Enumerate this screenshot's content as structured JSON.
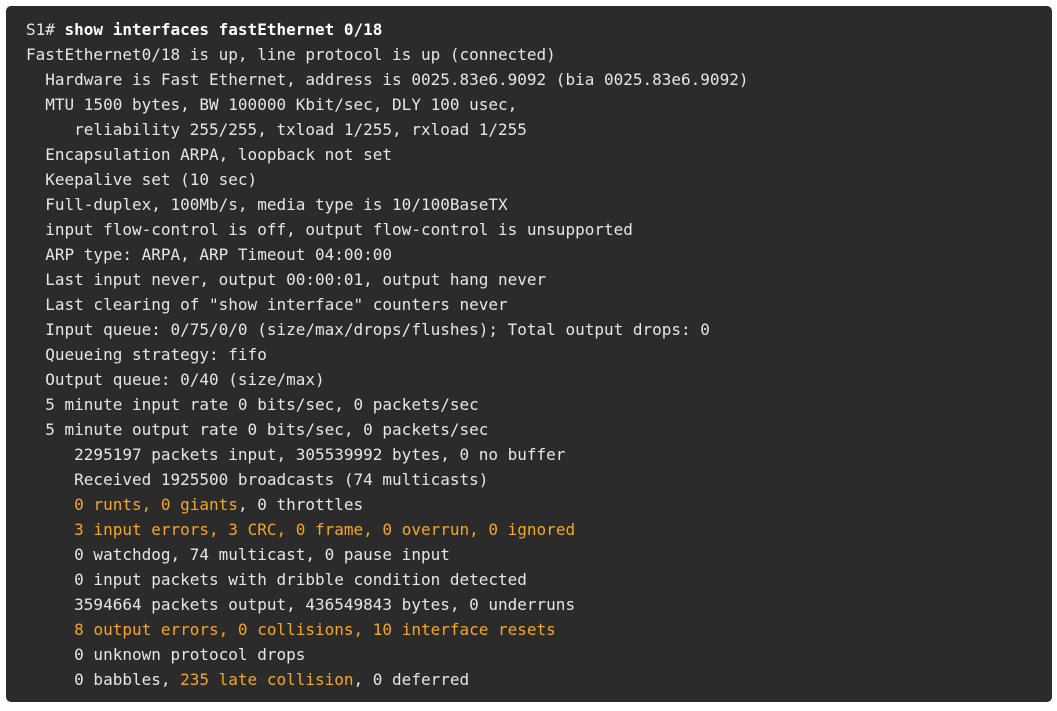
{
  "terminal": {
    "prompt": "S1# ",
    "command": "show interfaces fastEthernet 0/18",
    "lines": [
      [
        {
          "t": "FastEthernet0/18 is up, line protocol is up (connected)"
        }
      ],
      [
        {
          "t": "  Hardware is Fast Ethernet, address is 0025.83e6.9092 (bia 0025.83e6.9092)"
        }
      ],
      [
        {
          "t": "  MTU 1500 bytes, BW 100000 Kbit/sec, DLY 100 usec,"
        }
      ],
      [
        {
          "t": "     reliability 255/255, txload 1/255, rxload 1/255"
        }
      ],
      [
        {
          "t": "  Encapsulation ARPA, loopback not set"
        }
      ],
      [
        {
          "t": "  Keepalive set (10 sec)"
        }
      ],
      [
        {
          "t": "  Full-duplex, 100Mb/s, media type is 10/100BaseTX"
        }
      ],
      [
        {
          "t": "  input flow-control is off, output flow-control is unsupported"
        }
      ],
      [
        {
          "t": "  ARP type: ARPA, ARP Timeout 04:00:00"
        }
      ],
      [
        {
          "t": "  Last input never, output 00:00:01, output hang never"
        }
      ],
      [
        {
          "t": "  Last clearing of \"show interface\" counters never"
        }
      ],
      [
        {
          "t": "  Input queue: 0/75/0/0 (size/max/drops/flushes); Total output drops: 0"
        }
      ],
      [
        {
          "t": "  Queueing strategy: fifo"
        }
      ],
      [
        {
          "t": "  Output queue: 0/40 (size/max)"
        }
      ],
      [
        {
          "t": "  5 minute input rate 0 bits/sec, 0 packets/sec"
        }
      ],
      [
        {
          "t": "  5 minute output rate 0 bits/sec, 0 packets/sec"
        }
      ],
      [
        {
          "t": "     2295197 packets input, 305539992 bytes, 0 no buffer"
        }
      ],
      [
        {
          "t": "     Received 1925500 broadcasts (74 multicasts)"
        }
      ],
      [
        {
          "t": "     "
        },
        {
          "t": "0 runts, 0 giants",
          "hl": true
        },
        {
          "t": ", 0 throttles"
        }
      ],
      [
        {
          "t": "     "
        },
        {
          "t": "3 input errors, 3 CRC, 0 frame, 0 overrun, 0 ignored",
          "hl": true
        }
      ],
      [
        {
          "t": "     0 watchdog, 74 multicast, 0 pause input"
        }
      ],
      [
        {
          "t": "     0 input packets with dribble condition detected"
        }
      ],
      [
        {
          "t": "     3594664 packets output, 436549843 bytes, 0 underruns"
        }
      ],
      [
        {
          "t": "     "
        },
        {
          "t": "8 output errors, 0 collisions, 10 interface resets",
          "hl": true
        }
      ],
      [
        {
          "t": "     0 unknown protocol drops"
        }
      ],
      [
        {
          "t": "     0 babbles, "
        },
        {
          "t": "235 late collision",
          "hl": true
        },
        {
          "t": ", 0 deferred"
        }
      ]
    ]
  },
  "colors": {
    "background": "#2b2b2b",
    "text": "#e6e6e6",
    "highlight": "#f5a623"
  }
}
